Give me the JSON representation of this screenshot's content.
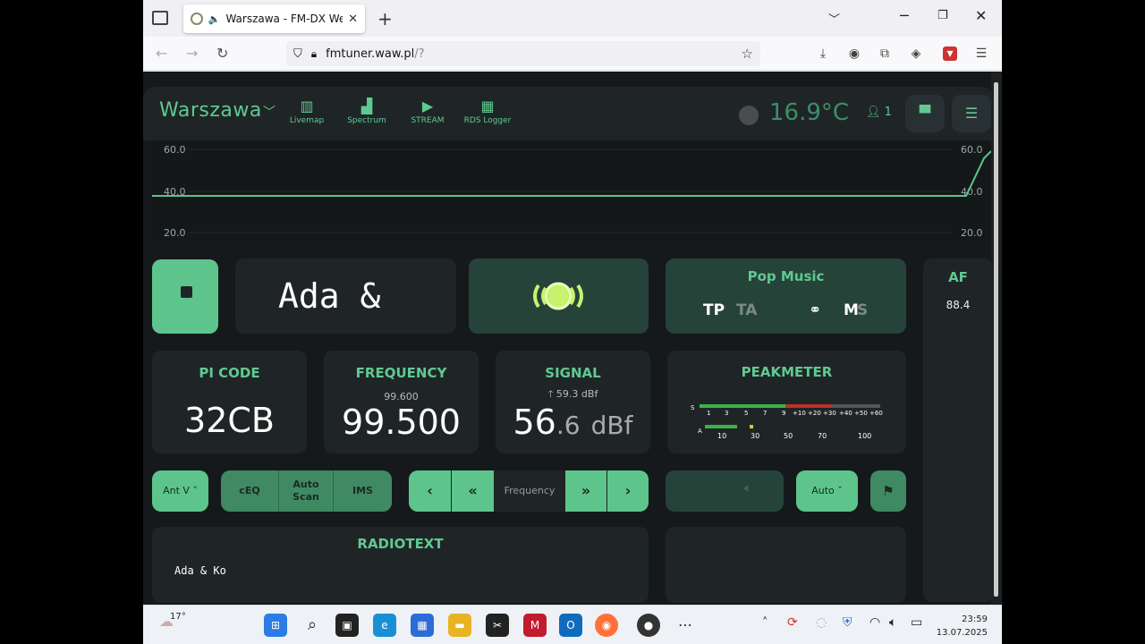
{
  "browser": {
    "tab_title": "Warszawa - FM-DX Webserver",
    "url_domain": "fmtuner.waw.pl",
    "url_path": "/?"
  },
  "header": {
    "city": "Warszawa",
    "nav": [
      {
        "label": "Livemap",
        "icon": "map-icon"
      },
      {
        "label": "Spectrum",
        "icon": "chart-area-icon"
      },
      {
        "label": "STREAM",
        "icon": "play-icon"
      },
      {
        "label": "RDS Logger",
        "icon": "table-icon"
      }
    ],
    "temperature": "16.9°C",
    "users": "1"
  },
  "graph": {
    "y_labels": [
      "60.0",
      "40.0",
      "20.0"
    ],
    "line_color": "#5dc58c"
  },
  "station": {
    "ps": "Ada &",
    "pty": "Pop Music",
    "tp": "TP",
    "ta": "TA",
    "ms_m": "M",
    "ms_s": "S"
  },
  "af": {
    "label": "AF",
    "items": [
      "88.4"
    ]
  },
  "pi": {
    "label": "PI CODE",
    "value": "32CB"
  },
  "frequency": {
    "label": "FREQUENCY",
    "prev": "99.600",
    "value": "99.500"
  },
  "signal": {
    "label": "SIGNAL",
    "peak": "59.3 dBf",
    "int": "56",
    "dec": ".6",
    "unit": "dBf"
  },
  "peakmeter": {
    "label": "PEAKMETER",
    "s_letter": "S",
    "s_scale": [
      "1",
      "3",
      "5",
      "7",
      "9",
      "+10",
      "+20",
      "+30",
      "+40",
      "+50",
      "+60"
    ],
    "a_letter": "A",
    "a_scale": [
      "10",
      "30",
      "50",
      "70",
      "100"
    ]
  },
  "controls": {
    "antenna": "Ant V",
    "ceq": "cEQ",
    "autoscan_1": "Auto",
    "autoscan_2": "Scan",
    "ims": "IMS",
    "freq_label": "Frequency",
    "mode": "Auto"
  },
  "radiotext": {
    "label": "RADIOTEXT",
    "text": "Ada & Ko"
  },
  "taskbar": {
    "weather": "17°",
    "time": "23:59",
    "date": "13.07.2025"
  }
}
